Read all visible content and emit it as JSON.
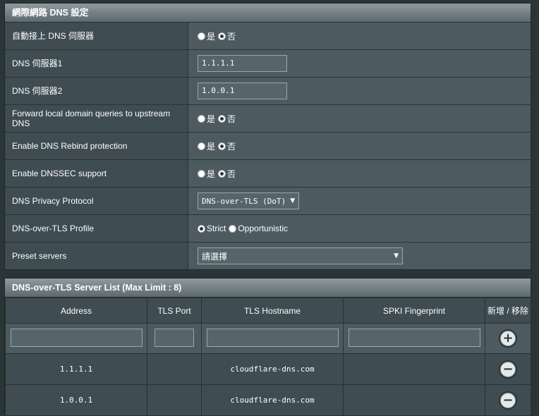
{
  "wan_dns": {
    "title": "網際網路 DNS 設定",
    "rows": {
      "auto_dns": {
        "label": "自動接上 DNS 伺服器",
        "opt_yes": "是",
        "opt_no": "否",
        "selected": "no"
      },
      "dns1": {
        "label": "DNS 伺服器1",
        "value": "1.1.1.1"
      },
      "dns2": {
        "label": "DNS 伺服器2",
        "value": "1.0.0.1"
      },
      "forward_local": {
        "label": "Forward local domain queries to upstream DNS",
        "opt_yes": "是",
        "opt_no": "否",
        "selected": "no"
      },
      "rebind": {
        "label": "Enable DNS Rebind protection",
        "opt_yes": "是",
        "opt_no": "否",
        "selected": "no"
      },
      "dnssec": {
        "label": "Enable DNSSEC support",
        "opt_yes": "是",
        "opt_no": "否",
        "selected": "no"
      },
      "privacy_protocol": {
        "label": "DNS Privacy Protocol",
        "value": "DNS-over-TLS (DoT)"
      },
      "tls_profile": {
        "label": "DNS-over-TLS Profile",
        "opt_strict": "Strict",
        "opt_opportunistic": "Opportunistic",
        "selected": "strict"
      },
      "preset": {
        "label": "Preset servers",
        "value": "請選擇"
      }
    }
  },
  "server_list": {
    "title": "DNS-over-TLS Server List (Max Limit : 8)",
    "headers": {
      "address": "Address",
      "tls_port": "TLS Port",
      "tls_hostname": "TLS Hostname",
      "spki": "SPKI Fingerprint",
      "add_remove": "新增 / 移除"
    },
    "entries": [
      {
        "address": "1.1.1.1",
        "port": "",
        "hostname": "cloudflare-dns.com",
        "spki": ""
      },
      {
        "address": "1.0.0.1",
        "port": "",
        "hostname": "cloudflare-dns.com",
        "spki": ""
      }
    ],
    "add_symbol": "+",
    "remove_symbol": "−"
  }
}
